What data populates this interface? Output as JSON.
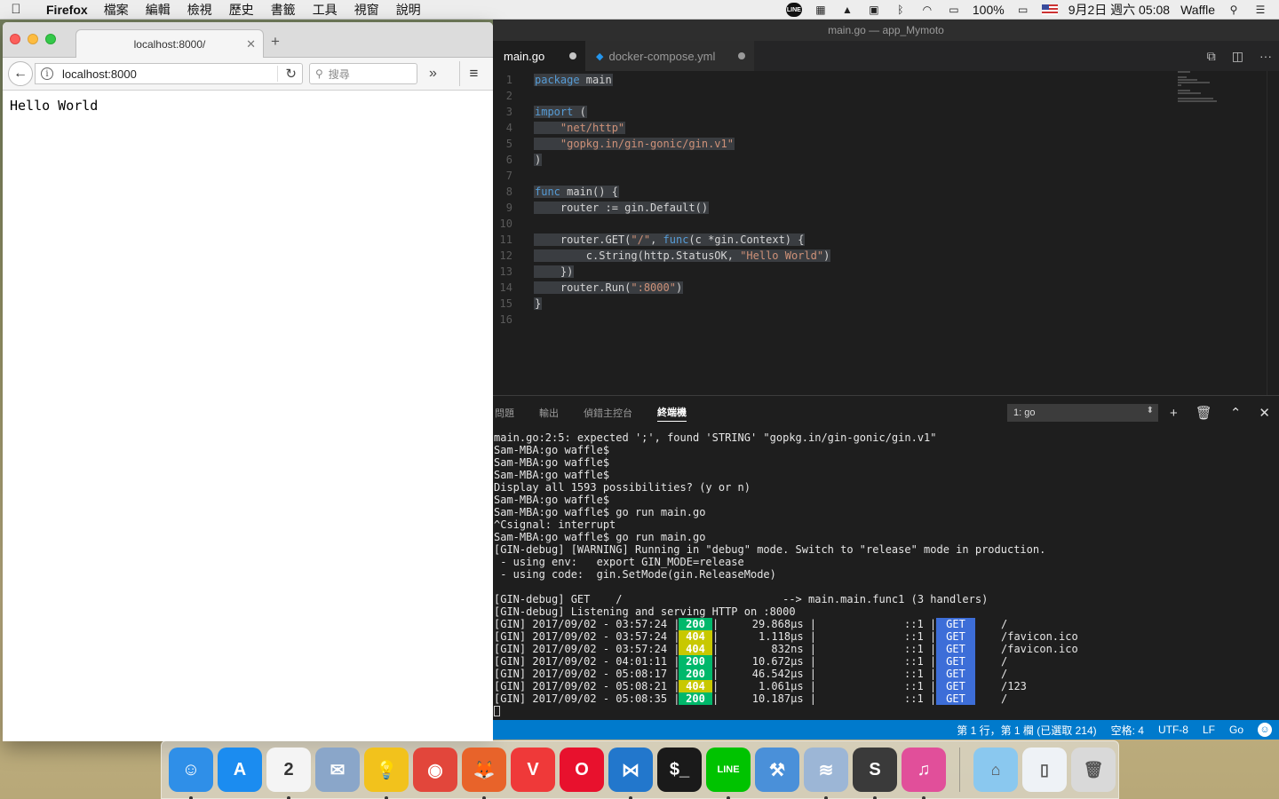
{
  "menubar": {
    "apple": "",
    "app_name": "Firefox",
    "menus": [
      "檔案",
      "編輯",
      "檢視",
      "歷史",
      "書籤",
      "工具",
      "視窗",
      "說明"
    ],
    "status": {
      "line_badge": "LINE",
      "battery": "100%",
      "datetime": "9月2日 週六 05:08",
      "user": "Waffle"
    }
  },
  "firefox": {
    "tab_title": "localhost:8000/",
    "url": "localhost:8000",
    "search_placeholder": "搜尋",
    "page_text": "Hello World"
  },
  "vscode": {
    "window_title": "main.go — app_Mymoto",
    "tabs": [
      {
        "label": "main.go",
        "active": true,
        "dirty": true
      },
      {
        "label": "docker-compose.yml",
        "active": false,
        "dirty": true
      }
    ],
    "code_lines": [
      {
        "n": "1",
        "parts": [
          [
            "kw",
            "package"
          ],
          [
            "p",
            " main"
          ]
        ]
      },
      {
        "n": "2",
        "parts": []
      },
      {
        "n": "3",
        "parts": [
          [
            "kw",
            "import"
          ],
          [
            "p",
            " ("
          ]
        ]
      },
      {
        "n": "4",
        "parts": [
          [
            "p",
            "    "
          ],
          [
            "str",
            "\"net/http\""
          ]
        ]
      },
      {
        "n": "5",
        "parts": [
          [
            "p",
            "    "
          ],
          [
            "str",
            "\"gopkg.in/gin-gonic/gin.v1\""
          ]
        ]
      },
      {
        "n": "6",
        "parts": [
          [
            "p",
            ")"
          ]
        ]
      },
      {
        "n": "7",
        "parts": []
      },
      {
        "n": "8",
        "parts": [
          [
            "kw",
            "func"
          ],
          [
            "p",
            " main() {"
          ]
        ]
      },
      {
        "n": "9",
        "parts": [
          [
            "p",
            "    router := gin.Default()"
          ]
        ]
      },
      {
        "n": "10",
        "parts": []
      },
      {
        "n": "11",
        "parts": [
          [
            "p",
            "    router.GET("
          ],
          [
            "str",
            "\"/\""
          ],
          [
            "p",
            ", "
          ],
          [
            "kw",
            "func"
          ],
          [
            "p",
            "(c *gin.Context) {"
          ]
        ]
      },
      {
        "n": "12",
        "parts": [
          [
            "p",
            "        c.String(http.StatusOK, "
          ],
          [
            "str",
            "\"Hello World\""
          ],
          [
            "p",
            ")"
          ]
        ]
      },
      {
        "n": "13",
        "parts": [
          [
            "p",
            "    })"
          ]
        ]
      },
      {
        "n": "14",
        "parts": [
          [
            "p",
            "    router.Run("
          ],
          [
            "str",
            "\":8000\""
          ],
          [
            "p",
            ")"
          ]
        ]
      },
      {
        "n": "15",
        "parts": [
          [
            "p",
            "}"
          ]
        ]
      },
      {
        "n": "16",
        "parts": []
      }
    ],
    "panel": {
      "tabs": [
        "問題",
        "輸出",
        "偵錯主控台",
        "終端機"
      ],
      "active_tab": "終端機",
      "terminal_select": "1: go"
    },
    "terminal_lines": [
      "main.go:2:5: expected ';', found 'STRING' \"gopkg.in/gin-gonic/gin.v1\"",
      "Sam-MBA:go waffle$",
      "Sam-MBA:go waffle$",
      "Sam-MBA:go waffle$",
      "Display all 1593 possibilities? (y or n)",
      "Sam-MBA:go waffle$",
      "Sam-MBA:go waffle$ go run main.go",
      "^Csignal: interrupt",
      "Sam-MBA:go waffle$ go run main.go",
      "[GIN-debug] [WARNING] Running in \"debug\" mode. Switch to \"release\" mode in production.",
      " - using env:   export GIN_MODE=release",
      " - using code:  gin.SetMode(gin.ReleaseMode)",
      "",
      "[GIN-debug] GET    /                         --> main.main.func1 (3 handlers)",
      "[GIN-debug] Listening and serving HTTP on :8000"
    ],
    "gin_logs": [
      {
        "prefix": "[GIN] 2017/09/02 - 03:57:24 |",
        "status": "200",
        "latency": "29.868µs |",
        "ip": "::1 |",
        "method": "GET",
        "path": "/"
      },
      {
        "prefix": "[GIN] 2017/09/02 - 03:57:24 |",
        "status": "404",
        "latency": "1.118µs |",
        "ip": "::1 |",
        "method": "GET",
        "path": "/favicon.ico"
      },
      {
        "prefix": "[GIN] 2017/09/02 - 03:57:24 |",
        "status": "404",
        "latency": "832ns |",
        "ip": "::1 |",
        "method": "GET",
        "path": "/favicon.ico"
      },
      {
        "prefix": "[GIN] 2017/09/02 - 04:01:11 |",
        "status": "200",
        "latency": "10.672µs |",
        "ip": "::1 |",
        "method": "GET",
        "path": "/"
      },
      {
        "prefix": "[GIN] 2017/09/02 - 05:08:17 |",
        "status": "200",
        "latency": "46.542µs |",
        "ip": "::1 |",
        "method": "GET",
        "path": "/"
      },
      {
        "prefix": "[GIN] 2017/09/02 - 05:08:21 |",
        "status": "404",
        "latency": "1.061µs |",
        "ip": "::1 |",
        "method": "GET",
        "path": "/123"
      },
      {
        "prefix": "[GIN] 2017/09/02 - 05:08:35 |",
        "status": "200",
        "latency": "10.187µs |",
        "ip": "::1 |",
        "method": "GET",
        "path": "/"
      }
    ],
    "statusbar": {
      "position": "第 1 行，第 1 欄 (已選取 214)",
      "indent": "空格: 4",
      "encoding": "UTF-8",
      "eol": "LF",
      "language": "Go"
    }
  },
  "dock": {
    "items": [
      {
        "name": "finder-icon",
        "glyph": "☺",
        "color": "#2f8fe8",
        "running": true
      },
      {
        "name": "app-store-icon",
        "glyph": "A",
        "color": "#1b8cf0",
        "running": false
      },
      {
        "name": "calendar-icon",
        "glyph": "2",
        "color": "#f4f4f4",
        "running": true
      },
      {
        "name": "preview-icon",
        "glyph": "✉",
        "color": "#8aa6c9",
        "running": false
      },
      {
        "name": "lightbulb-icon",
        "glyph": "💡",
        "color": "#f2c21c",
        "running": true
      },
      {
        "name": "chrome-icon",
        "glyph": "◉",
        "color": "#e2463b",
        "running": false
      },
      {
        "name": "firefox-icon",
        "glyph": "🦊",
        "color": "#e8632a",
        "running": true
      },
      {
        "name": "vivaldi-icon",
        "glyph": "V",
        "color": "#ef3939",
        "running": false
      },
      {
        "name": "opera-icon",
        "glyph": "O",
        "color": "#e8112d",
        "running": false
      },
      {
        "name": "vscode-icon",
        "glyph": "⋈",
        "color": "#2277cc",
        "running": true
      },
      {
        "name": "terminal-icon",
        "glyph": "$_",
        "color": "#1a1a1a",
        "running": false
      },
      {
        "name": "line-icon",
        "glyph": "LINE",
        "color": "#00c300",
        "running": true
      },
      {
        "name": "xcode-icon",
        "glyph": "⚒",
        "color": "#4a90d9",
        "running": false
      },
      {
        "name": "stack-icon",
        "glyph": "≋",
        "color": "#9cb6d6",
        "running": true
      },
      {
        "name": "sublime-icon",
        "glyph": "S",
        "color": "#3a3a3a",
        "running": true
      },
      {
        "name": "itunes-icon",
        "glyph": "♫",
        "color": "#e14f9a",
        "running": true
      }
    ],
    "right_items": [
      {
        "name": "applications-folder-icon",
        "glyph": "⌂",
        "color": "#8ac8ef"
      },
      {
        "name": "document-icon",
        "glyph": "▯",
        "color": "#eef2f6"
      },
      {
        "name": "trash-icon",
        "glyph": "🗑",
        "color": "#d9d9d9"
      }
    ]
  }
}
